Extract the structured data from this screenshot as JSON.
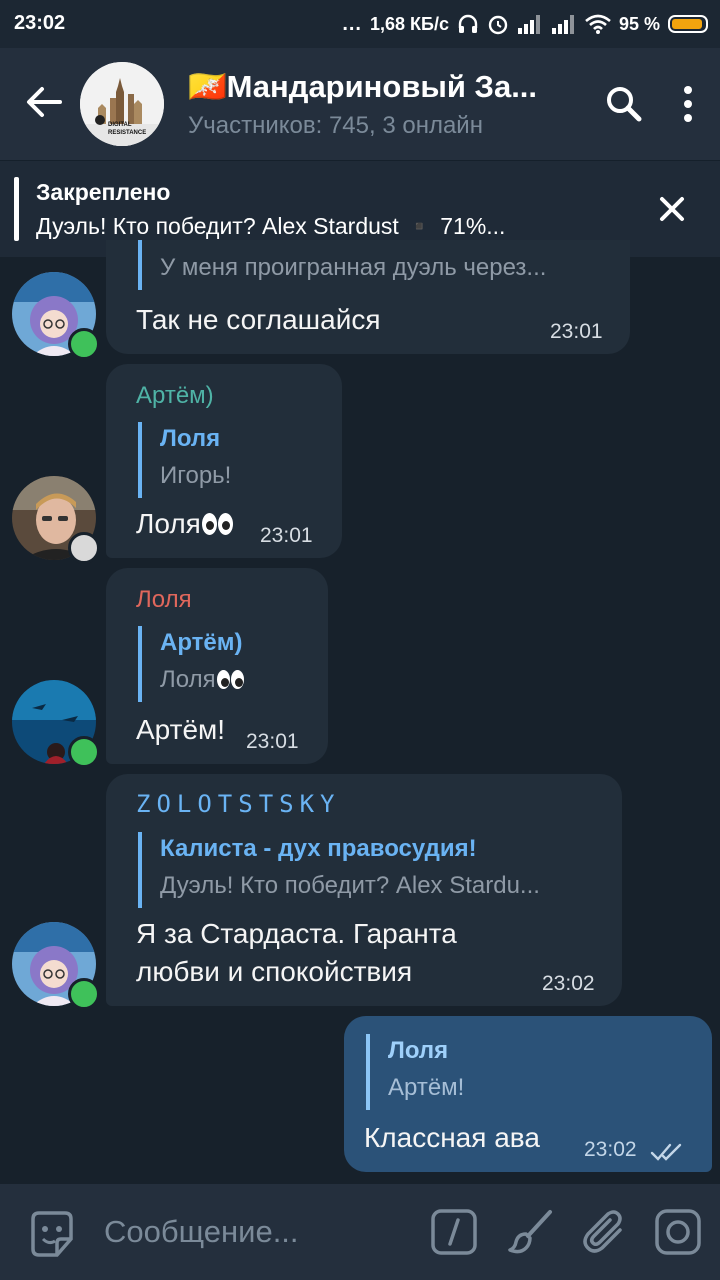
{
  "status_bar": {
    "time": "23:02",
    "dots": "...",
    "network_speed": "1,68 КБ/с",
    "battery": "95 %"
  },
  "header": {
    "title": "🇧🇹Мандариновый За...",
    "subtitle": "Участников: 745, 3 онлайн",
    "avatar_text_1": "DIGITAL",
    "avatar_text_2": "RESISTANCE"
  },
  "pinned": {
    "label": "Закреплено",
    "text": "Дуэль! Кто победит?  Alex Stardust  ▪️ 71%..."
  },
  "messages": [
    {
      "reply_text": "У меня проигранная дуэль через...",
      "text": "Так не соглашайся",
      "time": "23:01"
    },
    {
      "sender": "Артём)",
      "reply_name": "Лоля",
      "reply_text": "Игорь!",
      "text": "Лоля",
      "time": "23:01"
    },
    {
      "sender": "Лоля",
      "reply_name": "Артём)",
      "reply_text": "Лоля",
      "text": "Артём!",
      "time": "23:01"
    },
    {
      "sender": "ZOLOTSTSKY",
      "reply_name": "Калиста - дух правосудия!",
      "reply_text": "Дуэль! Кто победит?  Alex Stardu...",
      "text_line1": "Я за Стардаста. Гаранта",
      "text_line2": "любви и спокойствия",
      "time": "23:02"
    },
    {
      "reply_name": "Лоля",
      "reply_text": "Артём!",
      "text": "Классная ава",
      "time": "23:02"
    }
  ],
  "input": {
    "placeholder": "Сообщение..."
  },
  "colors": {
    "background": "#17212b",
    "header": "#242f3d",
    "bubble_in": "#222e3a",
    "bubble_out": "#2b5278",
    "accent": "#6ab3f3",
    "online": "#3fc15a",
    "name_artem": "#4fb3a6",
    "name_lolya": "#e0675c",
    "battery": "#f2a40e"
  },
  "icons": [
    "back-arrow-icon",
    "search-icon",
    "more-vertical-icon",
    "close-icon",
    "sticker-icon",
    "command-icon",
    "paint-brush-icon",
    "attach-icon",
    "camera-icon",
    "double-check-icon",
    "wifi-icon",
    "signal-icon",
    "alarm-icon",
    "headphones-icon"
  ]
}
